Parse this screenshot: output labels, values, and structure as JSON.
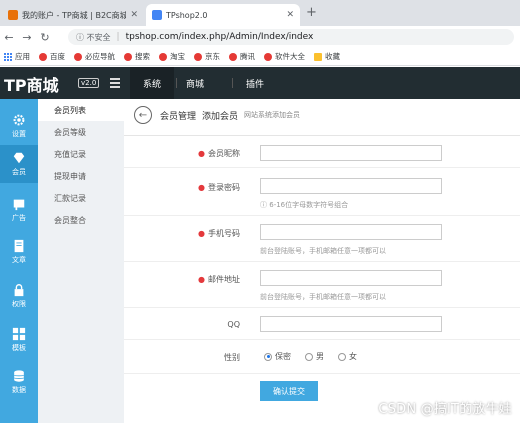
{
  "browser": {
    "tabs": [
      {
        "title": "我的账户 - TP商城 | B2C商城",
        "color": "#e8710a"
      },
      {
        "title": "TPshop2.0",
        "color": "#4285f4"
      }
    ],
    "new_tab": "+",
    "url_warning": "不安全",
    "url": "tpshop.com/index.php/Admin/Index/index",
    "bookmarks": [
      {
        "label": "应用",
        "type": "apps"
      },
      {
        "label": "百度",
        "color": "#e53935"
      },
      {
        "label": "必应导航",
        "color": "#e53935"
      },
      {
        "label": "搜索",
        "color": "#e53935"
      },
      {
        "label": "淘宝",
        "color": "#e53935"
      },
      {
        "label": "京东",
        "color": "#e53935"
      },
      {
        "label": "腾讯",
        "color": "#e53935"
      },
      {
        "label": "软件大全",
        "color": "#e53935"
      },
      {
        "label": "收藏",
        "color": "#fbc02d"
      }
    ]
  },
  "header": {
    "logo": "TP商城",
    "version": "v2.0",
    "nav": [
      "系统",
      "商城",
      "插件"
    ]
  },
  "iconbar": [
    {
      "label": "设置",
      "icon": "gear-icon"
    },
    {
      "label": "会员",
      "icon": "diamond-icon",
      "active": true
    },
    {
      "label": "广告",
      "icon": "megaphone-icon"
    },
    {
      "label": "文章",
      "icon": "document-icon"
    },
    {
      "label": "权限",
      "icon": "lock-icon"
    },
    {
      "label": "模板",
      "icon": "grid-icon"
    },
    {
      "label": "数据",
      "icon": "database-icon"
    }
  ],
  "submenu": [
    {
      "label": "会员列表",
      "active": true
    },
    {
      "label": "会员等级"
    },
    {
      "label": "充值记录"
    },
    {
      "label": "提现申请"
    },
    {
      "label": "汇款记录"
    },
    {
      "label": "会员整合"
    }
  ],
  "breadcrumb": {
    "parent": "会员管理",
    "current": "添加会员",
    "desc": "网站系统添加会员"
  },
  "form": {
    "nickname_label": "会员昵称",
    "password_label": "登录密码",
    "password_hint": "6-16位字母数字符号组合",
    "mobile_label": "手机号码",
    "mobile_hint": "前台登陆账号，手机邮箱任意一项都可以",
    "email_label": "邮件地址",
    "email_hint": "前台登陆账号，手机邮箱任意一项都可以",
    "qq_label": "QQ",
    "gender_label": "性别",
    "gender_options": [
      "保密",
      "男",
      "女"
    ],
    "gender_selected": "保密",
    "submit_label": "确认提交"
  },
  "watermark": "CSDN @搞IT的放牛娃"
}
